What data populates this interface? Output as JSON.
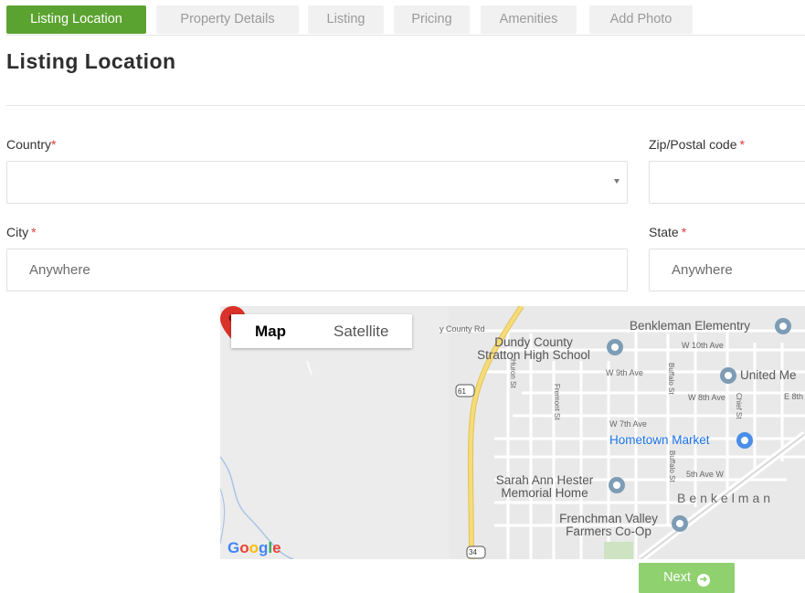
{
  "tabs": [
    {
      "label": "Listing Location",
      "active": true
    },
    {
      "label": "Property Details",
      "active": false
    },
    {
      "label": "Listing",
      "active": false
    },
    {
      "label": "Pricing",
      "active": false
    },
    {
      "label": "Amenities",
      "active": false
    },
    {
      "label": "Add Photo",
      "active": false
    }
  ],
  "page_title": "Listing Location",
  "form": {
    "country_label": "Country",
    "country_value": "",
    "zip_label": "Zip/Postal code",
    "city_label": "City",
    "city_value": "Anywhere",
    "state_label": "State",
    "state_value": "Anywhere",
    "required_mark": "*"
  },
  "map": {
    "type_map": "Map",
    "type_satellite": "Satellite",
    "attribution": "Google",
    "labels": {
      "county_rd": "y County Rd",
      "benkleman_elementary": "Benkleman Elementry",
      "dundy_county_1": "Dundy County",
      "dundy_county_2": "Stratton High School",
      "w10": "W 10th Ave",
      "w9": "W 9th Ave",
      "united": "United Me",
      "w8": "W 8th Ave",
      "e8": "E 8th",
      "w7": "W 7th Ave",
      "hometown": "Hometown Market",
      "fifth": "5th Ave W",
      "sarah_1": "Sarah Ann Hester",
      "sarah_2": "Memorial Home",
      "town": "Benkelman",
      "frenchman_1": "Frenchman Valley",
      "frenchman_2": "Farmers Co-Op",
      "route61": "61",
      "route34": "34",
      "huron": "Huron St",
      "fremont": "Fremont St",
      "buffalo": "Buffalo St",
      "chief": "Chief St",
      "buffalo2": "Buffalo St"
    },
    "colors": {
      "road_major": "#f2d56b",
      "pin": "#d9322a",
      "poi": "#7d9cb5",
      "market": "#4a8ee8"
    }
  },
  "next_label": "Next",
  "colors": {
    "accent": "#5ba331",
    "next_bg": "#8fd16f",
    "required": "#e03b3b"
  }
}
